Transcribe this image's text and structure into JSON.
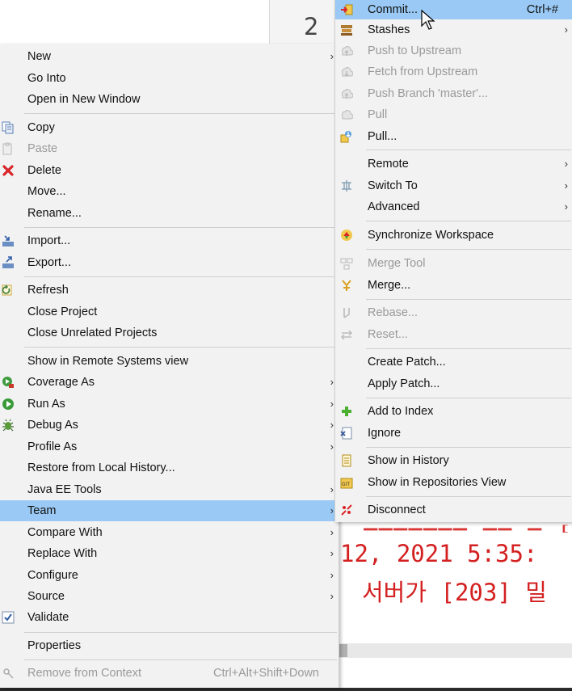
{
  "editor": {
    "line_number": "2"
  },
  "console": {
    "lines": [
      "12, 2021 5:35:",
      "서버가 [203] 밀"
    ]
  },
  "context_menu": {
    "items": [
      {
        "label": "New",
        "submenu": true
      },
      {
        "label": "Go Into"
      },
      {
        "label": "Open in New Window"
      },
      {
        "label": "Copy",
        "icon": "copy-icon"
      },
      {
        "label": "Paste",
        "icon": "paste-icon",
        "disabled": true
      },
      {
        "label": "Delete",
        "icon": "delete-icon"
      },
      {
        "label": "Move..."
      },
      {
        "label": "Rename..."
      },
      {
        "label": "Import...",
        "icon": "import-icon"
      },
      {
        "label": "Export...",
        "icon": "export-icon"
      },
      {
        "label": "Refresh",
        "icon": "refresh-icon"
      },
      {
        "label": "Close Project"
      },
      {
        "label": "Close Unrelated Projects"
      },
      {
        "label": "Show in Remote Systems view"
      },
      {
        "label": "Coverage As",
        "icon": "coverage-icon",
        "submenu": true
      },
      {
        "label": "Run As",
        "icon": "run-icon",
        "submenu": true
      },
      {
        "label": "Debug As",
        "icon": "debug-icon",
        "submenu": true
      },
      {
        "label": "Profile As",
        "submenu": true
      },
      {
        "label": "Restore from Local History..."
      },
      {
        "label": "Java EE Tools",
        "submenu": true
      },
      {
        "label": "Team",
        "submenu": true,
        "highlighted": true
      },
      {
        "label": "Compare With",
        "submenu": true
      },
      {
        "label": "Replace With",
        "submenu": true
      },
      {
        "label": "Configure",
        "submenu": true
      },
      {
        "label": "Source",
        "submenu": true
      },
      {
        "label": "Validate",
        "icon": "checkbox-checked-icon"
      },
      {
        "label": "Properties"
      },
      {
        "label": "Remove from Context",
        "icon": "remove-context-icon",
        "disabled": true,
        "accelerator": "Ctrl+Alt+Shift+Down"
      }
    ]
  },
  "team_menu": {
    "items": [
      {
        "label": "Commit...",
        "icon": "commit-icon",
        "accelerator": "Ctrl+#",
        "highlighted": true
      },
      {
        "label": "Stashes",
        "icon": "stashes-icon",
        "submenu": true
      },
      {
        "label": "Push to Upstream",
        "icon": "push-icon",
        "disabled": true
      },
      {
        "label": "Fetch from Upstream",
        "icon": "fetch-icon",
        "disabled": true
      },
      {
        "label": "Push Branch 'master'...",
        "icon": "push-branch-icon",
        "disabled": true
      },
      {
        "label": "Pull",
        "icon": "pull-icon",
        "disabled": true
      },
      {
        "label": "Pull...",
        "icon": "pull-dialog-icon"
      },
      {
        "label": "Remote",
        "submenu": true
      },
      {
        "label": "Switch To",
        "icon": "switch-branch-icon",
        "submenu": true
      },
      {
        "label": "Advanced",
        "submenu": true
      },
      {
        "label": "Synchronize Workspace",
        "icon": "synchronize-icon"
      },
      {
        "label": "Merge Tool",
        "icon": "merge-tool-icon",
        "disabled": true
      },
      {
        "label": "Merge...",
        "icon": "merge-icon"
      },
      {
        "label": "Rebase...",
        "icon": "rebase-icon",
        "disabled": true
      },
      {
        "label": "Reset...",
        "icon": "reset-icon",
        "disabled": true
      },
      {
        "label": "Create Patch..."
      },
      {
        "label": "Apply Patch..."
      },
      {
        "label": "Add to Index",
        "icon": "add-index-icon"
      },
      {
        "label": "Ignore",
        "icon": "ignore-icon"
      },
      {
        "label": "Show in History",
        "icon": "history-icon"
      },
      {
        "label": "Show in Repositories View",
        "icon": "repositories-icon"
      },
      {
        "label": "Disconnect",
        "icon": "disconnect-icon"
      }
    ]
  },
  "colors": {
    "highlight": "#99c9f4",
    "console_text": "#d42020",
    "menu_bg": "#f2f2f2"
  }
}
